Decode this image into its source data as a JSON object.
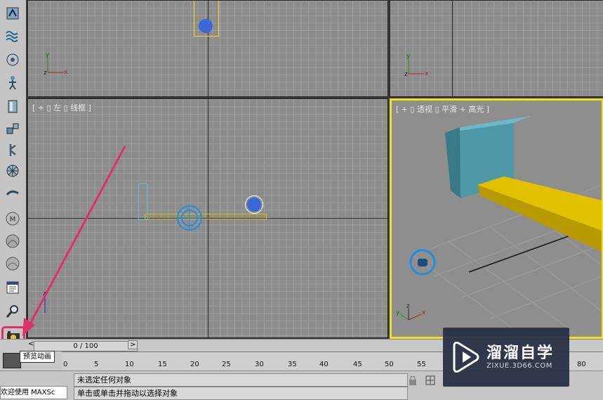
{
  "viewports": {
    "left_label": "[ + ▯ 左 ▯ 线框 ]",
    "perspective_label": "[ + ▯ 透视 ▯ 平滑 + 高光 ]",
    "axis_x": "x",
    "axis_y": "y",
    "axis_z": "z"
  },
  "timeline": {
    "slider_text": "0 / 100",
    "prev": "<",
    "next": ">",
    "ticks": [
      "0",
      "5",
      "10",
      "15",
      "20",
      "25",
      "30",
      "35",
      "40",
      "45",
      "50",
      "55",
      "80"
    ]
  },
  "tooltip": {
    "text": "预览动画"
  },
  "status": {
    "selection": "未选定任何对象",
    "prompt": "单击或单击并拖动以选择对象",
    "maxscript": "欢迎使用 MAXSc"
  },
  "watermark": {
    "title": "溜溜自学",
    "url": "ZIXUE.3D66.COM"
  },
  "colors": {
    "active_viewport_border": "#f0e020",
    "box_cyan": "#4f98a8",
    "plank_yellow": "#d4b000",
    "camera_blue": "#1d8ee0",
    "arrow": "#e0306a"
  },
  "toolbar_icons": [
    "space-warp-icon",
    "wave-icon",
    "bone-icon",
    "ik-icon",
    "box-tool-icon",
    "connect-icon",
    "figure-icon",
    "wheel-icon",
    "link-icon",
    "material-m-icon",
    "material-sphere-icon",
    "material-sphere-2-icon",
    "render-frame-icon",
    "zoom-icon",
    "preview-animation-icon"
  ]
}
